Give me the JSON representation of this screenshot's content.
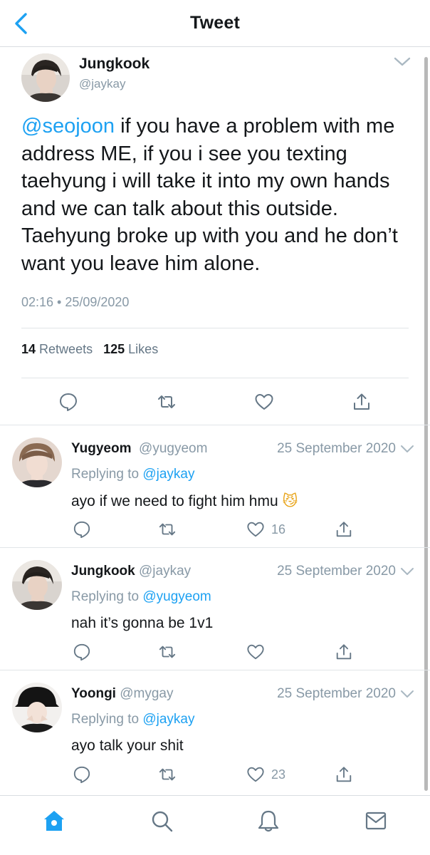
{
  "header": {
    "title": "Tweet",
    "back_icon": "chevron-left-icon"
  },
  "colors": {
    "accent": "#1da1f2",
    "muted": "#8899a6",
    "text": "#14171a",
    "divider": "#e1e5e8"
  },
  "tweet": {
    "author_name": "Jungkook",
    "author_handle": "@jaykay",
    "mention": "@seojoon",
    "body": " if you have a problem with me address ME, if you i see you texting taehyung i will take it into my own hands and we can talk about this outside. Taehyung broke up with you and he don’t want you leave him alone.",
    "timestamp": "02:16 • 25/09/2020",
    "retweets_count": "14",
    "retweets_label": "Retweets",
    "likes_count": "125",
    "likes_label": "Likes",
    "actions": [
      "reply-icon",
      "retweet-icon",
      "like-icon",
      "share-icon"
    ]
  },
  "replies": [
    {
      "name": "Yugyeom",
      "handle": "@yugyeom",
      "date": "25 September 2020",
      "replying_prefix": "Replying to ",
      "replying_to": "@jaykay",
      "text": "ayo if we need to fight him hmu",
      "emoji": "😼",
      "like_count": "16"
    },
    {
      "name": "Jungkook",
      "handle": "@jaykay",
      "date": "25 September 2020",
      "replying_prefix": "Replying to ",
      "replying_to": "@yugyeom",
      "text": "nah it’s gonna be 1v1",
      "like_count": ""
    },
    {
      "name": "Yoongi",
      "handle": "@mygay",
      "date": "25 September 2020",
      "replying_prefix": "Replying to ",
      "replying_to": "@jaykay",
      "text": "ayo talk your shit",
      "like_count": "23"
    }
  ],
  "tabbar": {
    "items": [
      "home-icon",
      "search-icon",
      "notifications-icon",
      "messages-icon"
    ],
    "active": "home-icon"
  }
}
